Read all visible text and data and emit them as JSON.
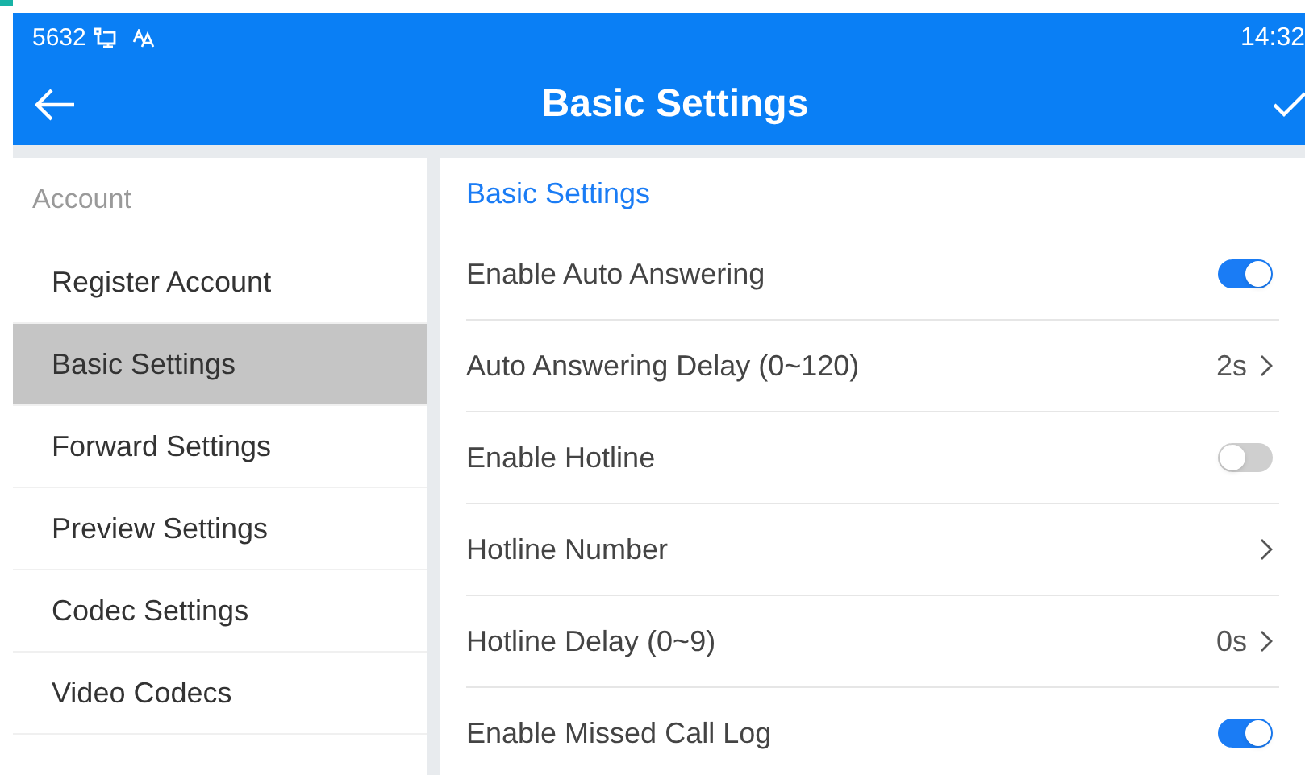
{
  "status_bar": {
    "extension": "5632",
    "time": "14:32"
  },
  "header": {
    "title": "Basic Settings"
  },
  "sidebar": {
    "section": "Account",
    "items": [
      {
        "label": "Register Account",
        "selected": false
      },
      {
        "label": "Basic Settings",
        "selected": true
      },
      {
        "label": "Forward Settings",
        "selected": false
      },
      {
        "label": "Preview Settings",
        "selected": false
      },
      {
        "label": "Codec Settings",
        "selected": false
      },
      {
        "label": "Video Codecs",
        "selected": false
      }
    ]
  },
  "panel": {
    "title": "Basic Settings",
    "rows": [
      {
        "kind": "toggle",
        "label": "Enable Auto Answering",
        "on": true
      },
      {
        "kind": "value",
        "label": "Auto Answering Delay (0~120)",
        "value": "2s"
      },
      {
        "kind": "toggle",
        "label": "Enable Hotline",
        "on": false
      },
      {
        "kind": "value",
        "label": "Hotline Number"
      },
      {
        "kind": "value",
        "label": "Hotline Delay (0~9)",
        "value": "0s"
      },
      {
        "kind": "toggle",
        "label": "Enable Missed Call Log",
        "on": true
      }
    ]
  }
}
